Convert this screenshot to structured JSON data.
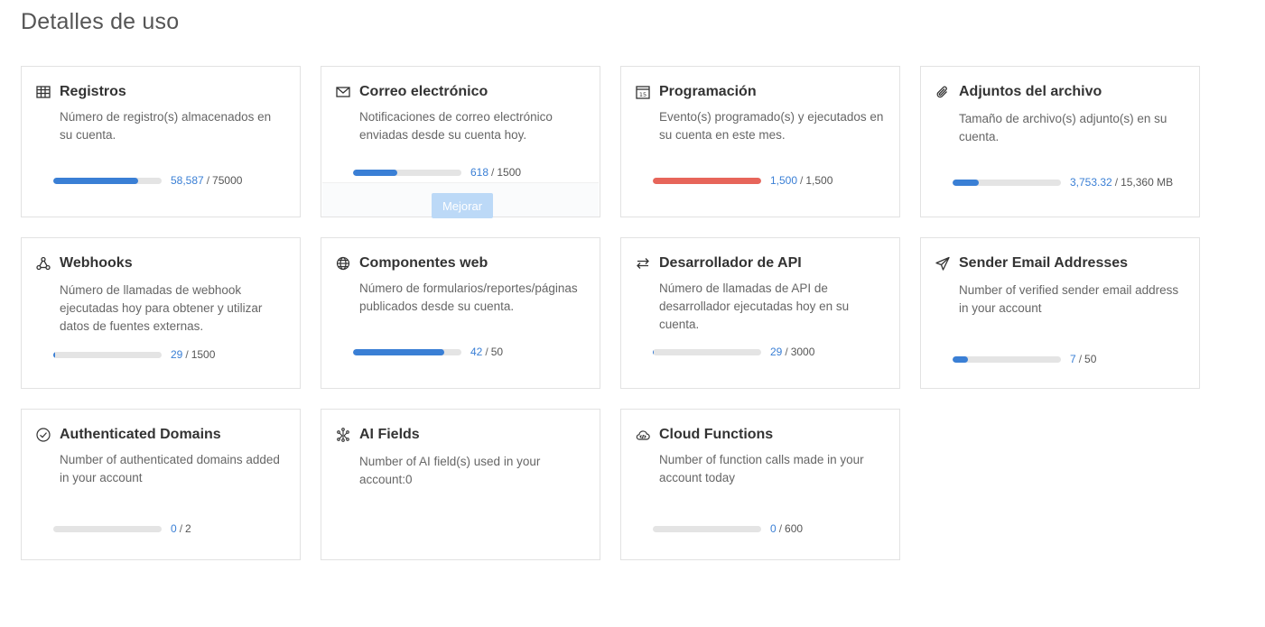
{
  "page": {
    "title": "Detalles de uso"
  },
  "cards": [
    {
      "title": "Registros",
      "icon": "table-icon",
      "desc": "Número de registro(s) almacenados en su cuenta.",
      "used": "58,587",
      "total": "75000",
      "fraction": 0.78
    },
    {
      "title": "Correo electrónico",
      "icon": "envelope-icon",
      "desc": "Notificaciones de correo electrónico enviadas desde su cuenta hoy.",
      "used": "618",
      "total": "1500",
      "fraction": 0.41,
      "upgrade_label": "Mejorar"
    },
    {
      "title": "Programación",
      "icon": "calendar-icon",
      "desc": "Evento(s) programado(s) y ejecutados en su cuenta en este mes.",
      "used": "1,500",
      "total": "1,500",
      "fraction": 1.0,
      "status_color": "#e7655a"
    },
    {
      "title": "Adjuntos del archivo",
      "icon": "paperclip-icon",
      "desc": "Tamaño de archivo(s) adjunto(s) en su cuenta.",
      "used": "3,753.32",
      "total": "15,360 MB",
      "fraction": 0.24
    },
    {
      "title": "Webhooks",
      "icon": "webhook-icon",
      "desc": "Número de llamadas de webhook ejecutadas hoy para obtener y utilizar datos de fuentes externas.",
      "used": "29",
      "total": "1500",
      "fraction": 0.02
    },
    {
      "title": "Componentes web",
      "icon": "globe-icon",
      "desc": "Número de formularios/reportes/páginas publicados desde su cuenta.",
      "used": "42",
      "total": "50",
      "fraction": 0.84
    },
    {
      "title": "Desarrollador de API",
      "icon": "arrows-exchange-icon",
      "desc": "Número de llamadas de API de desarrollador ejecutadas hoy en su cuenta.",
      "used": "29",
      "total": "3000",
      "fraction": 0.01
    },
    {
      "title": "Sender Email Addresses",
      "icon": "paper-plane-icon",
      "desc": "Number of verified sender email address in your account",
      "used": "7",
      "total": "50",
      "fraction": 0.14
    },
    {
      "title": "Authenticated Domains",
      "icon": "check-circle-icon",
      "desc": "Number of authenticated domains added in your account",
      "used": "0",
      "total": "2",
      "fraction": 0
    },
    {
      "title": "AI Fields",
      "icon": "ai-nodes-icon",
      "desc": "Number of AI field(s) used in your account:0"
    },
    {
      "title": "Cloud Functions",
      "icon": "cloud-code-icon",
      "desc": "Number of function calls made in your account today",
      "used": "0",
      "total": "600",
      "fraction": 0
    }
  ]
}
